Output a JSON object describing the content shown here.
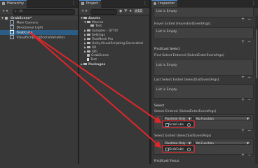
{
  "hierarchy": {
    "tab_label": "Hierarchy",
    "add_label": "+ ▾",
    "search_placeholder": "All",
    "scene_name": "GrabScene*",
    "items": [
      {
        "label": "Main Camera"
      },
      {
        "label": "Directional Light"
      },
      {
        "label": "GrabCube"
      },
      {
        "label": "VisualScriptingSceneVariables"
      }
    ]
  },
  "project": {
    "tab_label": "Project",
    "add_label": "+ ▾",
    "toolbar_icons": [
      "eye-icon",
      "filter-icon",
      "star-icon",
      "count-badge"
    ],
    "hidden_count": "10",
    "tree": [
      {
        "label": "Assets",
        "level": 0,
        "expanded": true,
        "bold": true
      },
      {
        "label": "Macros",
        "level": 1,
        "expanded": true
      },
      {
        "label": "Test",
        "level": 2,
        "expanded": false
      },
      {
        "label": "Samples - STYLY",
        "level": 1,
        "expanded": false
      },
      {
        "label": "Settings",
        "level": 1,
        "expanded": false
      },
      {
        "label": "TextMesh Pro",
        "level": 1,
        "expanded": false
      },
      {
        "label": "Unity.VisualScripting.Generated",
        "level": 1,
        "expanded": false
      },
      {
        "label": "XR",
        "level": 1,
        "expanded": false
      },
      {
        "label": "XRI",
        "level": 1,
        "expanded": false
      },
      {
        "label": "GrabScene",
        "level": 1,
        "expanded": false
      },
      {
        "label": "Test",
        "level": 1,
        "expanded": false
      },
      {
        "label": "Packages",
        "level": 0,
        "expanded": false,
        "bold": true
      }
    ]
  },
  "inspector": {
    "tab_label": "Inspector",
    "list_empty": "List is Empty",
    "hover_exited_label": "Hover Exited (HoverExitEventArgs)",
    "first_last_select_heading": "First/Last Select",
    "first_select_entered_label": "First Select Entered (SelectEnterEventArgs)",
    "last_select_exited_label": "Last Select Exited (SelectExitEventArgs)",
    "select_heading": "Select",
    "select_entered_label": "Select Entered (SelectEnterEventArgs)",
    "select_exited_label": "Select Exited (SelectExitEventArgs)",
    "runtime_only": "Runtime Only",
    "no_function": "No Function",
    "object_field_value": "GrabCube",
    "first_last_focus_heading": "First/Last Focus",
    "plus": "+",
    "minus": "−"
  },
  "colors": {
    "selection": "#2c5d87",
    "highlight": "#e0262a",
    "panel_bg": "#383838"
  }
}
